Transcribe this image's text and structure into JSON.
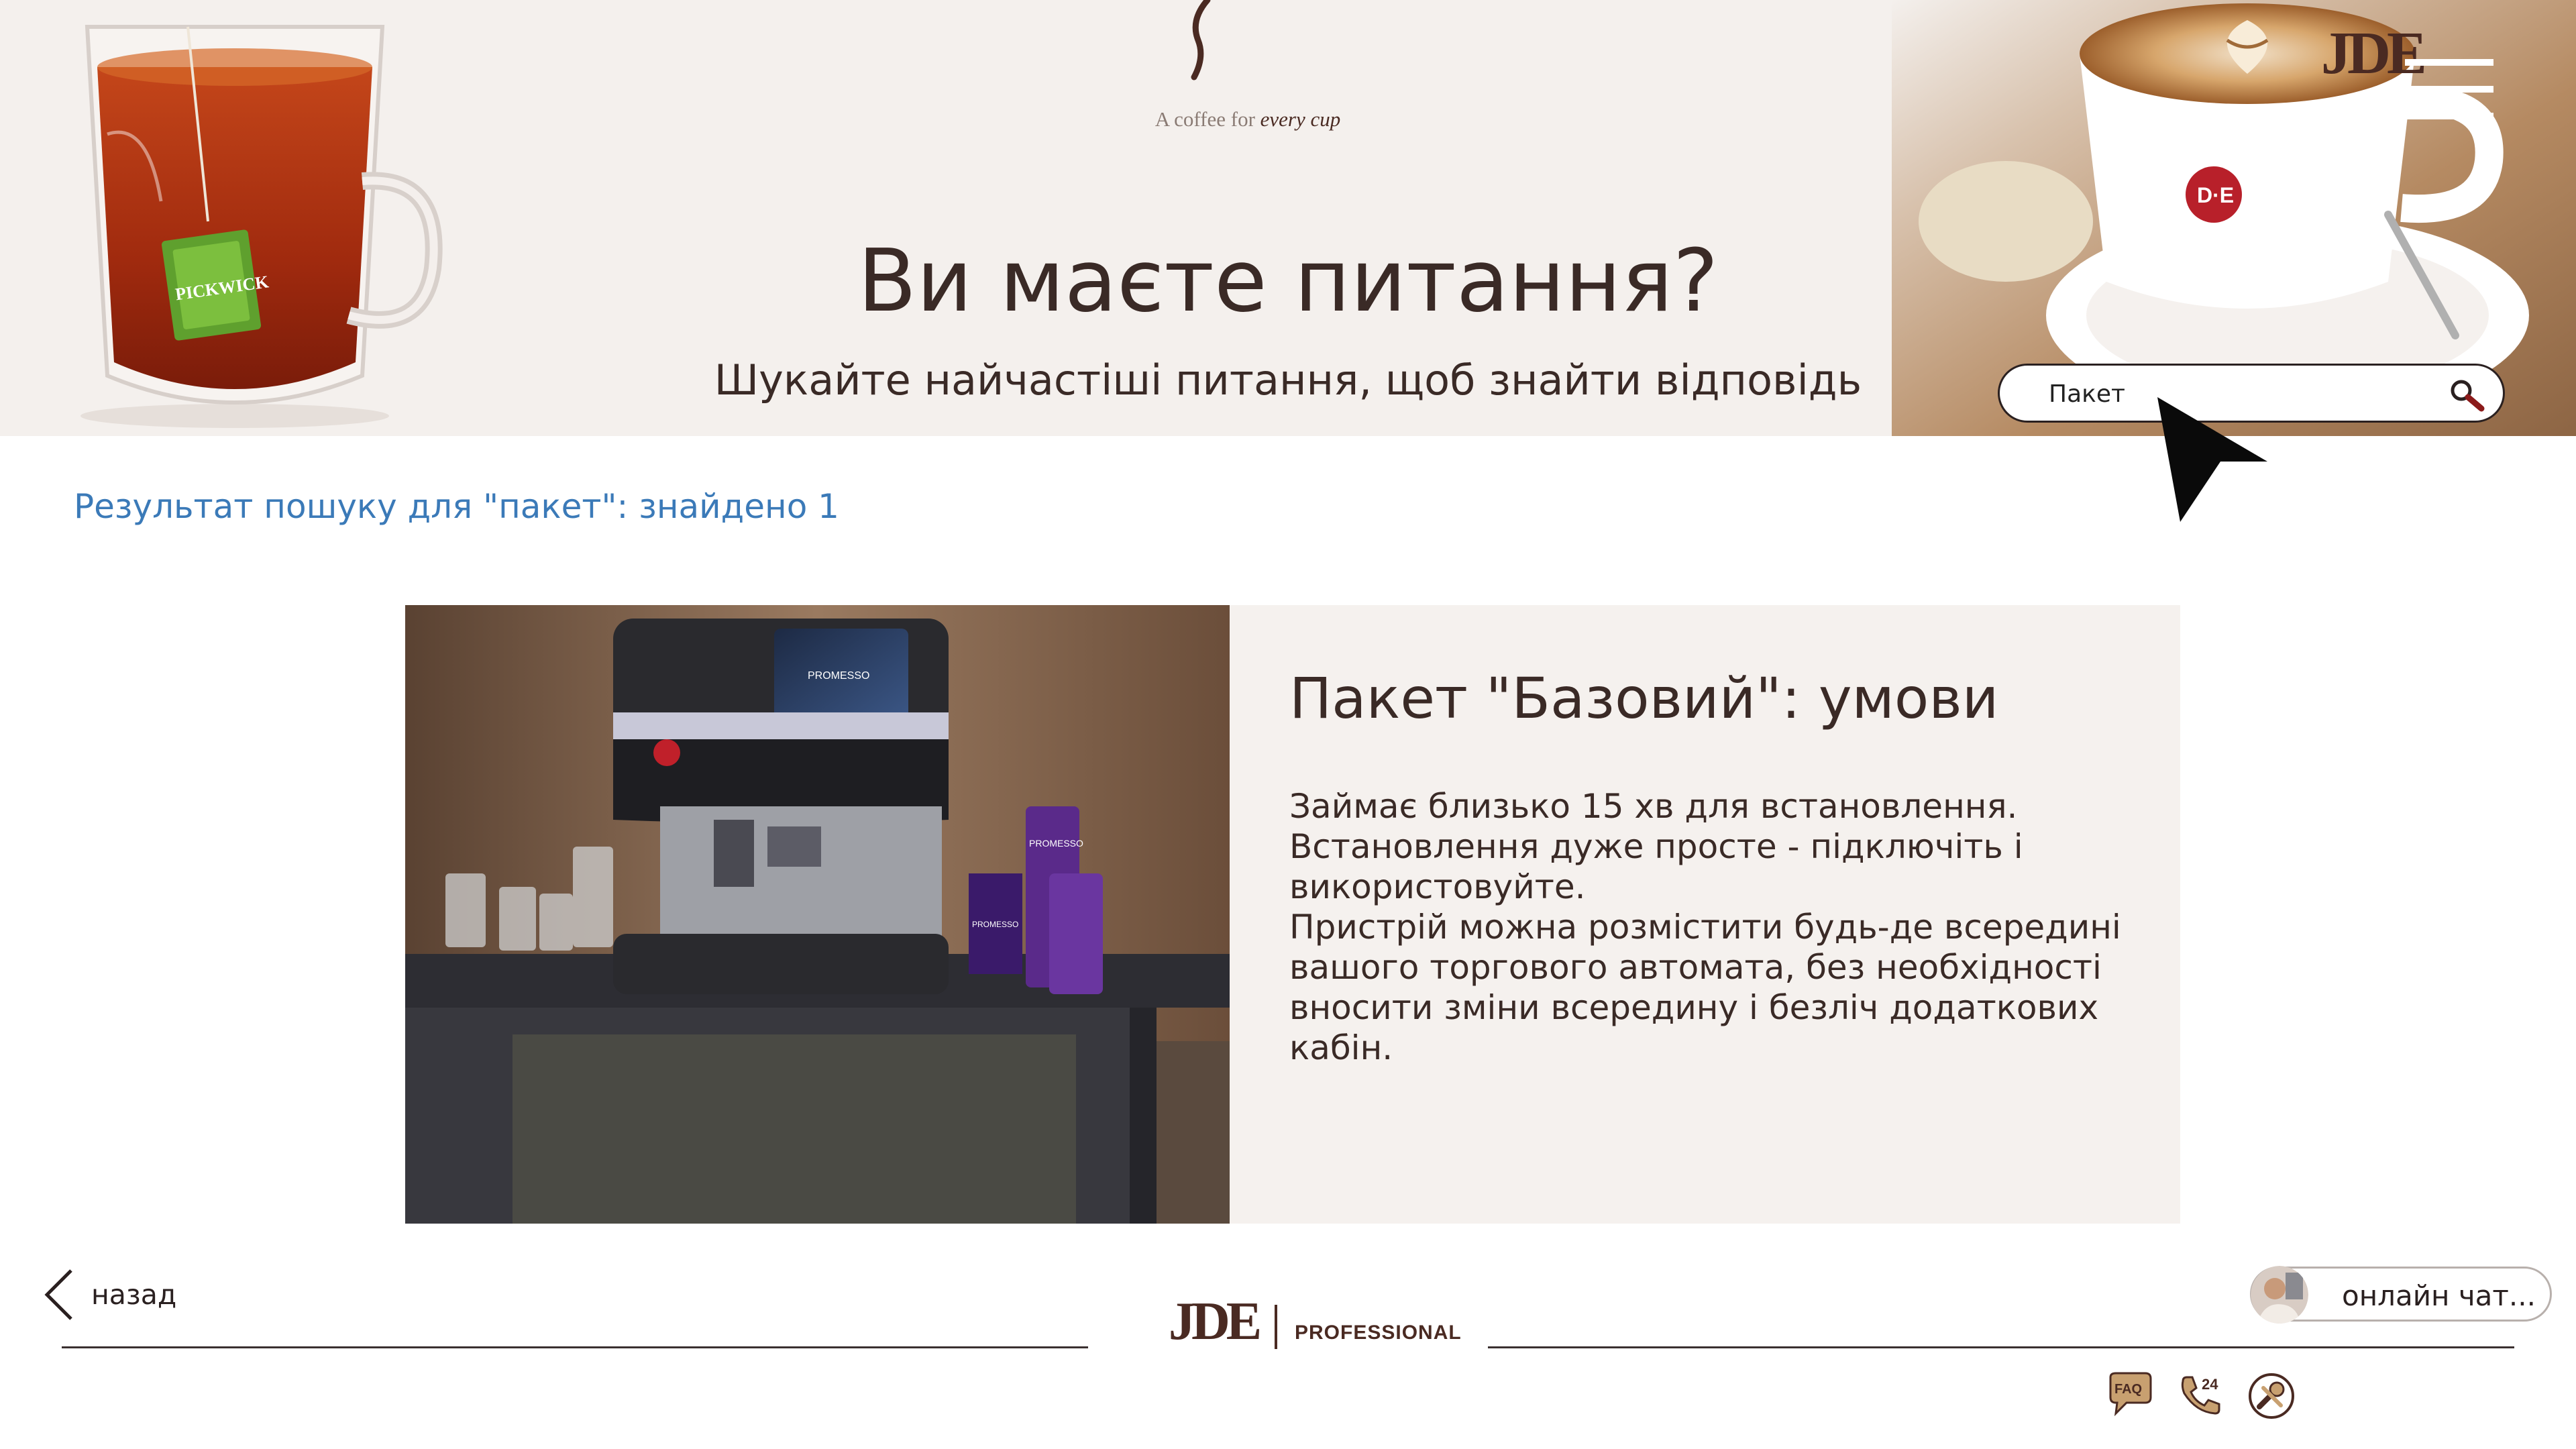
{
  "header": {
    "logo": "JDE",
    "tagline_plain": "A coffee for ",
    "tagline_em": "every cup",
    "title": "Ви маєте питання?",
    "subtitle": "Шукайте найчастіші питання, щоб знайти відповідь"
  },
  "search": {
    "value": "Пакет"
  },
  "results": {
    "summary": "Результат пошуку для \"пакет\": знайдено 1",
    "items": [
      {
        "title": "Пакет \"Базовий\": умови",
        "body": [
          "Займає близько 15 хв для встановлення.",
          "Встановлення дуже просте - підключіть і використовуйте.",
          "Пристрій можна розмістити будь-де всередині вашого торгового автомата, без необхідності вносити зміни всередину і безліч додаткових кабін."
        ],
        "image_labels": [
          "PROMESSO",
          "PROMESSO",
          "PROMESSO"
        ]
      }
    ]
  },
  "footer": {
    "back_label": "назад",
    "chat_label": "онлайн чат...",
    "logo_main": "JDE",
    "logo_sub": "PROFESSIONAL",
    "faq_label": "FAQ",
    "phone_label": "24"
  },
  "icons": {
    "menu": "hamburger-menu-icon",
    "search": "magnifier-icon",
    "back": "chevron-left-icon",
    "faq": "faq-chat-icon",
    "phone": "phone-24-icon",
    "tools": "tools-wrench-icon"
  },
  "colors": {
    "brand_brown": "#4a2a22",
    "hero_bg": "#f4f0ed",
    "link_blue": "#3b7ab8",
    "card_bg": "#f5f1ee",
    "search_icon": "#8b1a1a"
  }
}
